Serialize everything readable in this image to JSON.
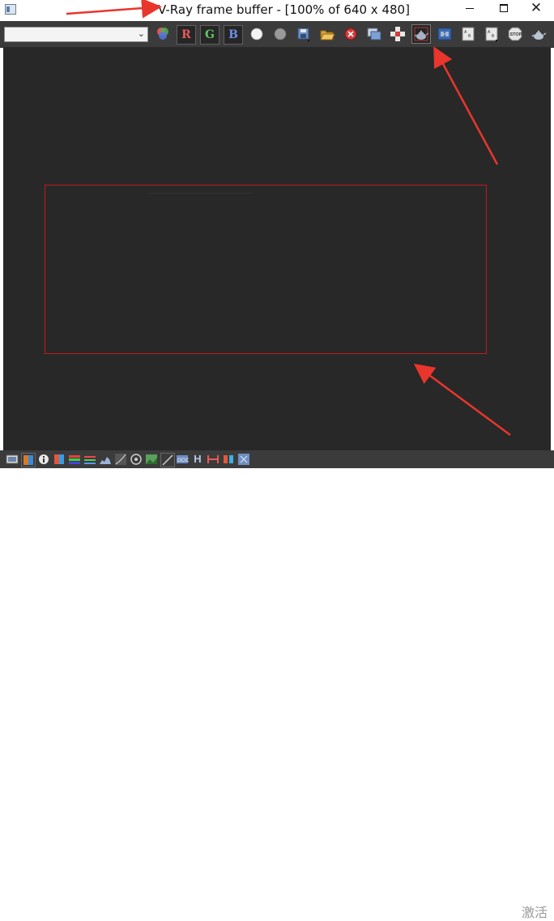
{
  "window": {
    "title": "V-Ray frame buffer - [100% of 640 x 480]",
    "min_glyph": "",
    "close_glyph": "✕"
  },
  "toolbar": {
    "channel_select_value": "",
    "r_label": "R",
    "g_label": "G",
    "b_label": "B",
    "icons": [
      "color-wheel-icon",
      "r-channel-button",
      "g-channel-button",
      "b-channel-button",
      "white-dot-icon",
      "gray-dot-icon",
      "save-icon",
      "open-folder-icon",
      "clear-icon",
      "duplicate-icon",
      "track-mouse-icon",
      "region-render-icon",
      "link-icon",
      "compare-a-icon",
      "compare-b-icon",
      "stop-icon",
      "render-teapot-icon"
    ]
  },
  "bottombar": {
    "h_label": "H",
    "watermark": "激活"
  },
  "colors": {
    "toolbar_bg": "#3b3b3b",
    "canvas_bg": "#282828",
    "region_border": "#c21a1a",
    "annotation_arrow": "#e8362c"
  }
}
